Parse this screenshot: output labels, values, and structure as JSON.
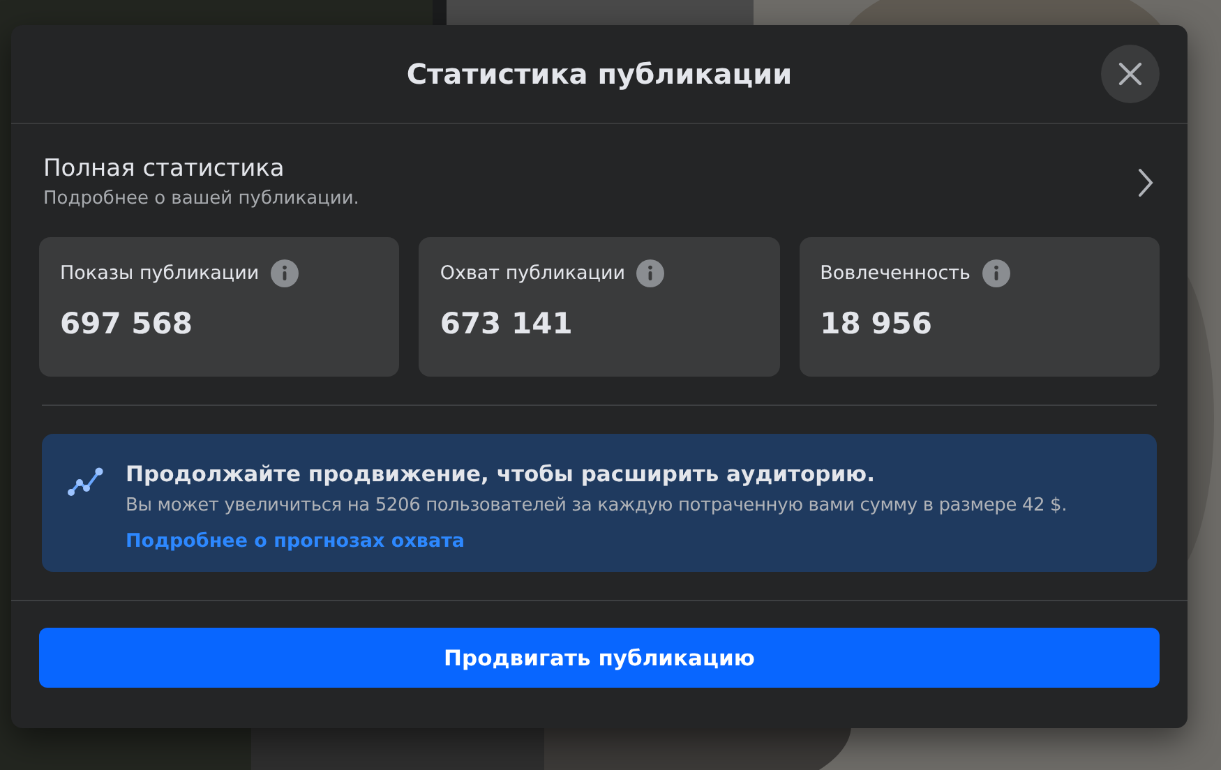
{
  "dialog": {
    "title": "Статистика публикации"
  },
  "full_stats": {
    "title": "Полная статистика",
    "subtitle": "Подробнее о вашей публикации."
  },
  "metrics": [
    {
      "label": "Показы публикации",
      "value": "697 568"
    },
    {
      "label": "Охват публикации",
      "value": "673 141"
    },
    {
      "label": "Вовлеченность",
      "value": "18 956"
    }
  ],
  "promo": {
    "title": "Продолжайте продвижение, чтобы расширить аудиторию.",
    "text": "Вы может увеличиться на 5206 пользователей за каждую потраченную вами сумму в размере 42 $.",
    "link": "Подробнее о прогнозах охвата"
  },
  "button": "Продвигать публикацию"
}
